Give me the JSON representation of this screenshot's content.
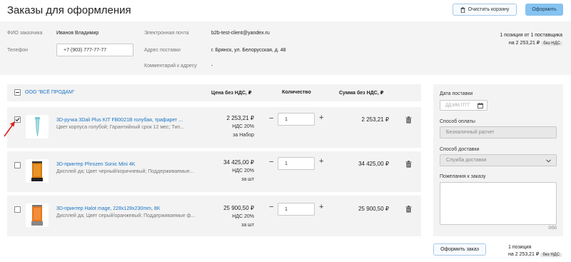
{
  "header": {
    "title": "Заказы для оформления",
    "clear_cart_label": "Очистить корзину",
    "checkout_label": "Оформить"
  },
  "customer": {
    "name_label": "ФИО заказчика",
    "name_value": "Иванов Владимир",
    "phone_label": "Телефон",
    "phone_value": "+7 (903) 777-77-77",
    "email_label": "Электронная почта",
    "email_value": "b2b-test-client@yandex.ru",
    "address_label": "Адрес поставки",
    "address_value": "г. Брянск, ул. Белорусская, д. 48",
    "comment_label": "Комментарий к адресу",
    "comment_value": "-"
  },
  "summary_top": {
    "line1": "1 позиция от 1 поставщика",
    "line2": "на 2 253,21 ₽",
    "badge": "без НДС"
  },
  "table": {
    "supplier": "ООО \"ВСЁ ПРОДАМ\"",
    "col_price": "Цена без НДС, ₽",
    "col_qty": "Количество",
    "col_sum": "Сумма без НДС, ₽"
  },
  "products": [
    {
      "checked": true,
      "name": "3D-ручка 3Dali Plus KIT FB0021B голубая, трафарет ...",
      "desc": "Цвет корпуса голубой; Гарантийный срок 12 мес; Тип...",
      "price": "2 253,21 ₽",
      "vat": "НДС 20%",
      "unit": "за Набор",
      "qty": "1",
      "sum": "2 253,21 ₽"
    },
    {
      "checked": false,
      "name": "3D-принтер Phrozen Sonic Mini 4K",
      "desc": "Дисплей да; Цвет черный/коричневый; Поддерживаемые...",
      "price": "34 425,00 ₽",
      "vat": "НДС 20%",
      "unit": "за шт",
      "qty": "1",
      "sum": "34 425,00 ₽"
    },
    {
      "checked": false,
      "name": "3D-принтер Halot mage, 228x128x230mm, 8K",
      "desc": "Дисплей да; Цвет серый/оранжевый; Поддерживаемые ф...",
      "price": "25 900,50 ₽",
      "vat": "НДС 20%",
      "unit": "за шт",
      "qty": "1",
      "sum": "25 900,50 ₽"
    }
  ],
  "side": {
    "delivery_date_label": "Дата поставки",
    "delivery_date_placeholder": "ДД.ММ.ГГГГ",
    "payment_label": "Способ оплаты",
    "payment_value": "Безналичный расчет",
    "delivery_method_label": "Способ доставки",
    "delivery_method_value": "Служба доставки",
    "wishes_label": "Пожелания к заказу",
    "counter": "0/50"
  },
  "footer": {
    "order_button": "Оформить заказ",
    "line1": "1 позиция",
    "line2": "на 2 253,21 ₽",
    "badge": "без НДС"
  },
  "colors": {
    "link": "#1a73c4",
    "primary_button": "#87c3f0",
    "annotation_arrow": "#e02020"
  }
}
